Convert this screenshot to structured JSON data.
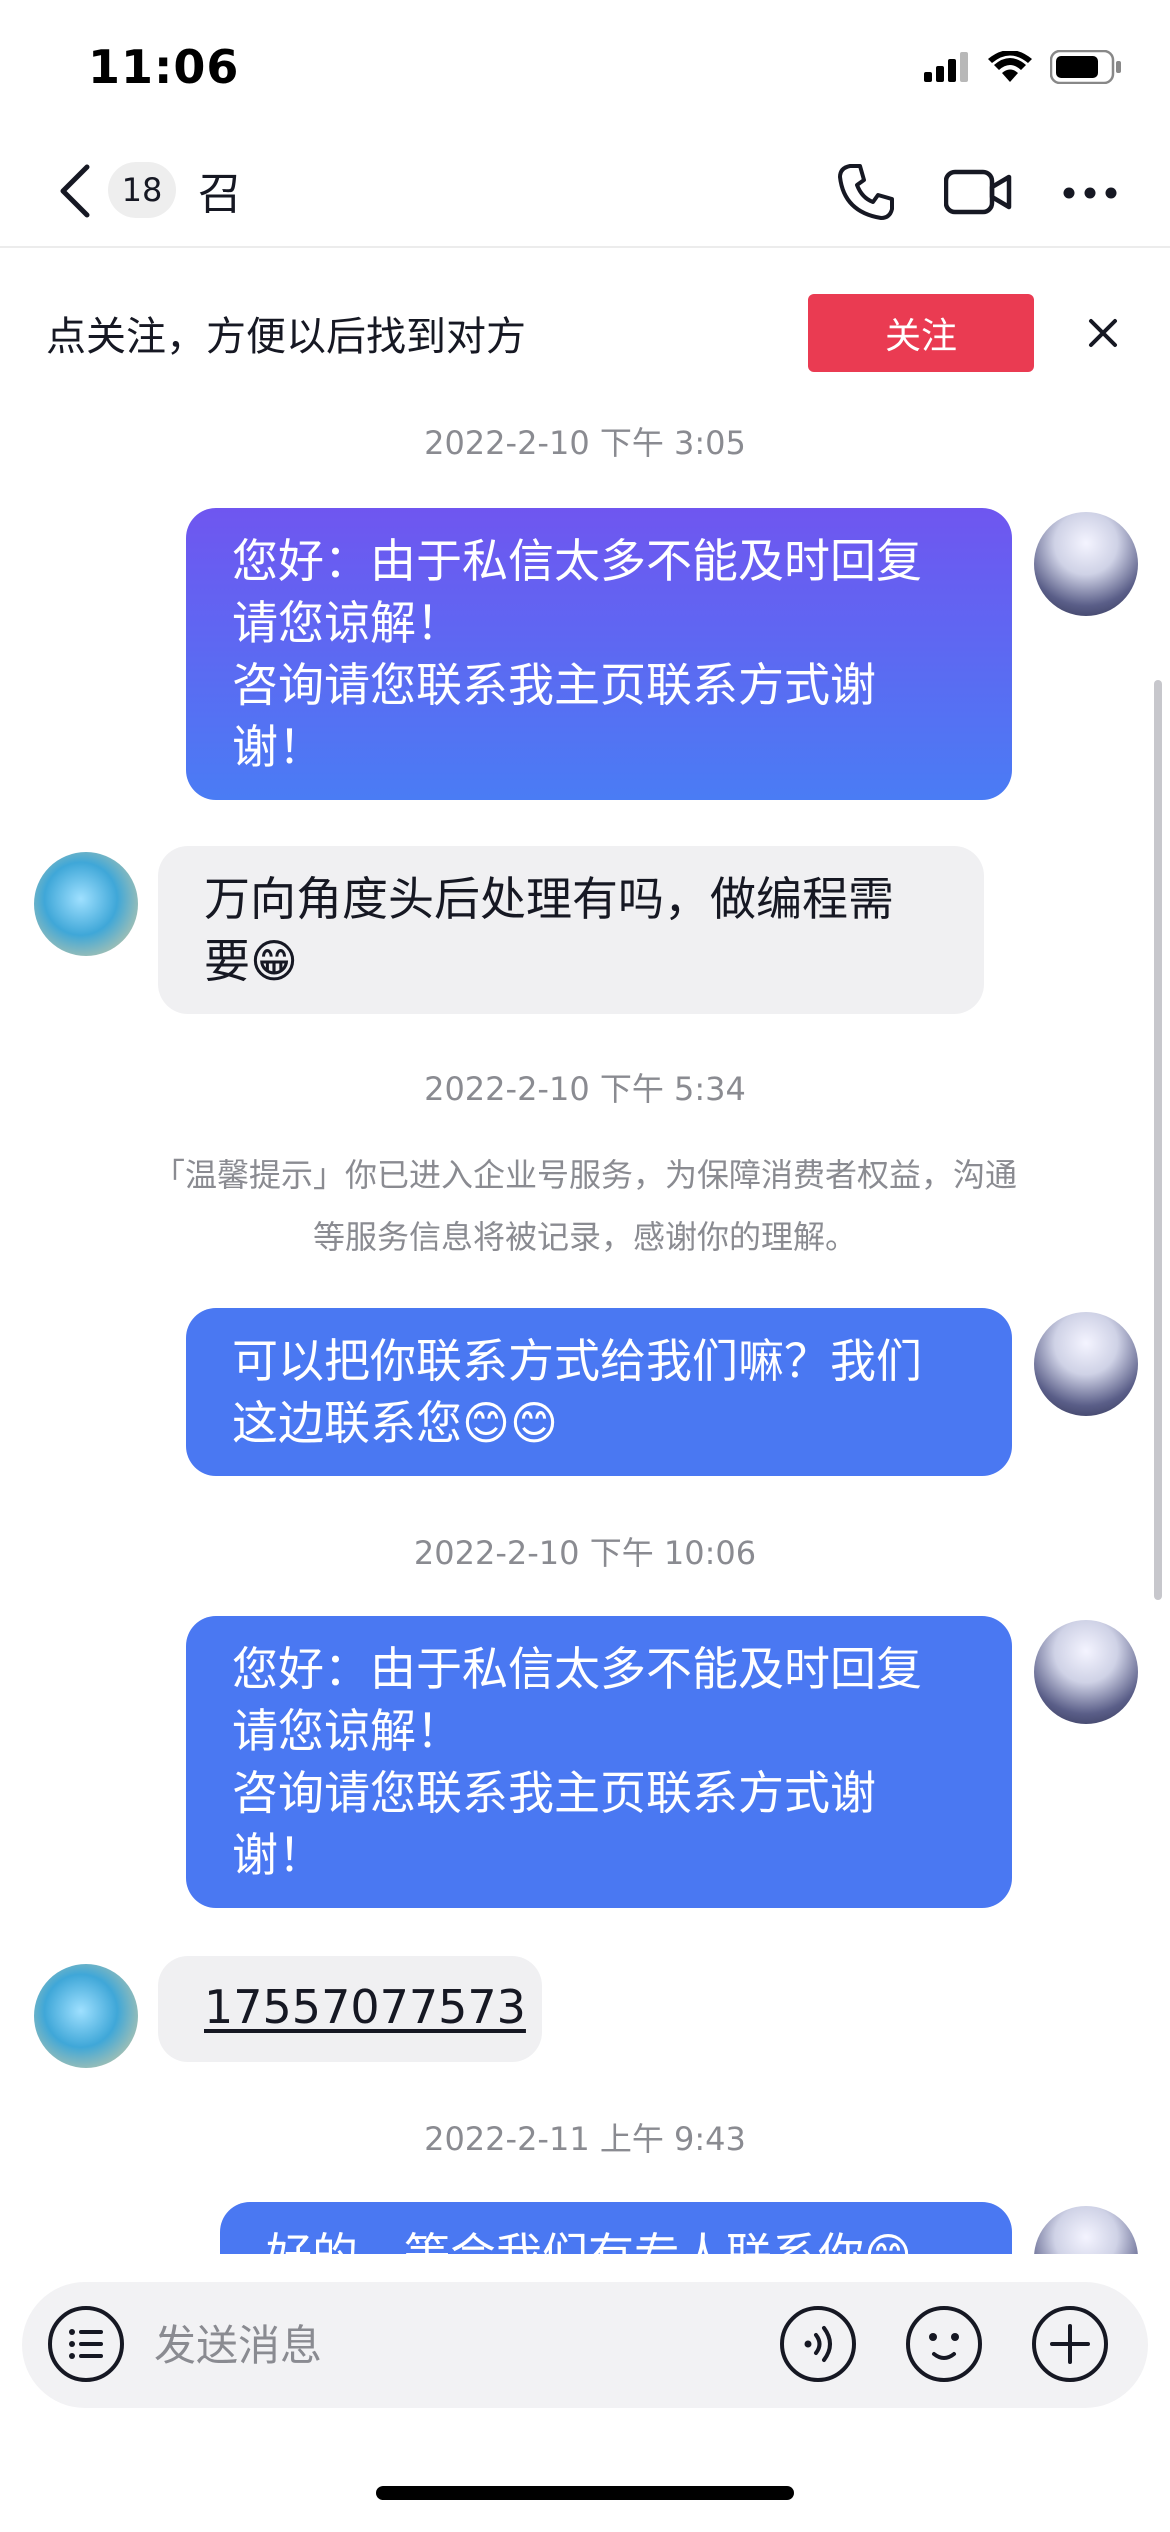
{
  "status_bar": {
    "time": "11:06",
    "icons": [
      "signal-icon",
      "wifi-icon",
      "battery-icon"
    ]
  },
  "header": {
    "back_icon": "chevron-left-icon",
    "unread_count": "18",
    "title": "召",
    "actions": [
      "phone-icon",
      "video-camera-icon",
      "more-icon"
    ]
  },
  "follow_banner": {
    "text": "点关注，方便以后找到对方",
    "button_label": "关注",
    "close_icon": "close-icon"
  },
  "messages": [
    {
      "type": "timestamp",
      "text": "2022-2-10 下午 3:05"
    },
    {
      "type": "outgoing",
      "lines": [
        "您好：由于私信太多不能及时回复",
        "请您谅解！",
        "咨询请您联系我主页联系方式谢",
        "谢！"
      ]
    },
    {
      "type": "incoming",
      "lines": [
        "万向角度头后处理有吗，做编程需",
        "要"
      ],
      "emoji": "😁"
    },
    {
      "type": "timestamp",
      "text": "2022-2-10 下午 5:34"
    },
    {
      "type": "system",
      "lines": [
        "「温馨提示」你已进入企业号服务，为保障消费者权益，沟通",
        "等服务信息将被记录，感谢你的理解。"
      ]
    },
    {
      "type": "outgoing",
      "lines": [
        "可以把你联系方式给我们嘛？我们",
        "这边联系您"
      ],
      "emoji": "😊😊"
    },
    {
      "type": "timestamp",
      "text": "2022-2-10 下午 10:06"
    },
    {
      "type": "outgoing",
      "lines": [
        "您好：由于私信太多不能及时回复",
        "请您谅解！",
        "咨询请您联系我主页联系方式谢",
        "谢！"
      ]
    },
    {
      "type": "incoming",
      "text": "17557077573"
    },
    {
      "type": "timestamp",
      "text": "2022-2-11 上午 9:43"
    },
    {
      "type": "outgoing",
      "text": "好的，等会我们有专人联系你",
      "emoji": "😊"
    }
  ],
  "input_bar": {
    "menu_icon": "list-menu-icon",
    "placeholder": "发送消息",
    "voice_icon": "voice-icon",
    "emoji_icon": "emoji-icon",
    "add_icon": "plus-icon"
  },
  "colors": {
    "accent_red": "#ea3b52",
    "bubble_blue": "#4a78f2",
    "bubble_purple": "#6f56f0",
    "incoming_gray": "#f0f0f2",
    "muted_text": "#8a8b91"
  }
}
